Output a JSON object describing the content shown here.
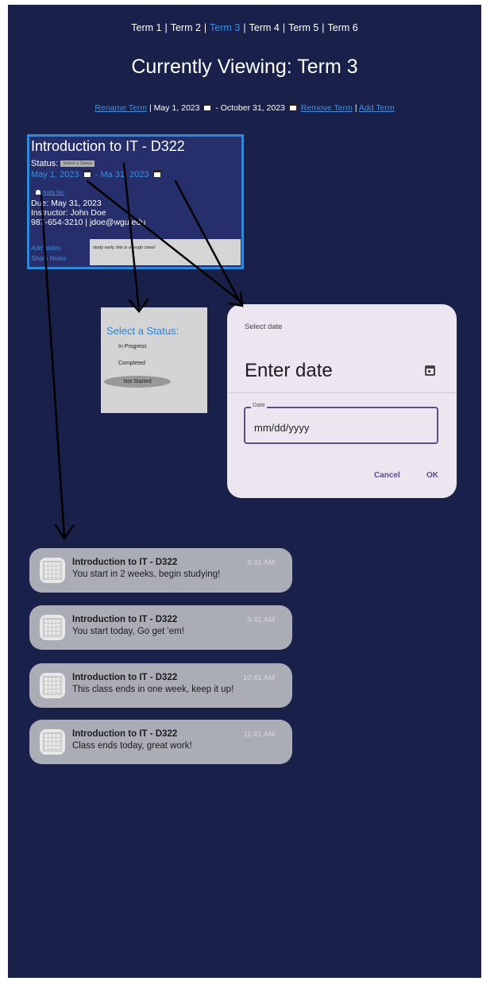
{
  "terms": [
    "Term 1",
    "Term 2",
    "Term 3",
    "Term 4",
    "Term 5",
    "Term 6"
  ],
  "active_term_index": 2,
  "page_title": "Currently Viewing: Term 3",
  "term_actions": {
    "rename": "Rename Term",
    "start_date": "May 1, 2023",
    "date_separator": "-",
    "end_date": "October 31, 2023",
    "remove": "Remove Term",
    "add": "Add Term"
  },
  "course": {
    "title": "Introduction to IT - D322",
    "status_label": "Status:",
    "status_select": "Select a Status",
    "start_date": "May 1, 2023",
    "end_date_partial": "- Ma",
    "end_date_rest": "31, 2023",
    "notify_label": "Notify Me!",
    "due": "Due: May 31, 2023",
    "instructor": "Instructor: John Doe",
    "contact": "987-654-3210 | jdoe@wgu.edu",
    "add_notes": "Add Notes",
    "share_notes": "Share Notes",
    "notes_text": "study early, this is a tough class!"
  },
  "status_popup": {
    "heading": "Select a Status:",
    "options": [
      "In Progress",
      "Completed",
      "Not Started"
    ],
    "selected_index": 2
  },
  "date_dialog": {
    "supporting_text": "Select date",
    "headline": "Enter date",
    "field_label": "Date",
    "field_value": "mm/dd/yyyy",
    "cancel_label": "Cancel",
    "ok_label": "OK"
  },
  "notifications": [
    {
      "title": "Introduction to IT - D322",
      "time": "8:41 AM",
      "message": "You start in 2 weeks, begin studying!"
    },
    {
      "title": "Introduction to IT - D322",
      "time": "9:41 AM",
      "message": "You start today, Go get 'em!"
    },
    {
      "title": "Introduction to IT - D322",
      "time": "10:41 AM",
      "message": "This class ends in one week, keep it up!"
    },
    {
      "title": "Introduction to IT - D322",
      "time": "11:41 AM",
      "message": "Class ends today, great work!"
    }
  ],
  "colors": {
    "background": "#19214b",
    "accent": "#3d8fe0",
    "course_card": "#262e6b",
    "dialog": "#ece6f0",
    "notification": "#aaacb6"
  },
  "icons": [
    "calendar-icon",
    "bell-icon",
    "app-icon"
  ]
}
